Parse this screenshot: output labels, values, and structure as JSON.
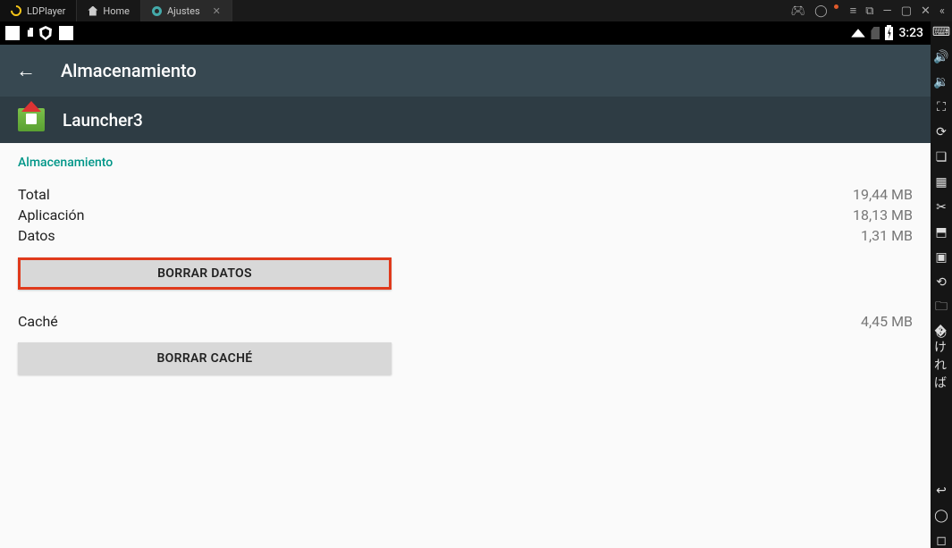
{
  "window": {
    "app_name": "LDPlayer",
    "tabs": [
      {
        "label": "Home"
      },
      {
        "label": "Ajustes"
      }
    ]
  },
  "status_bar": {
    "time": "3:23"
  },
  "appbar": {
    "title": "Almacenamiento"
  },
  "app_info": {
    "name": "Launcher3"
  },
  "storage": {
    "section_label": "Almacenamiento",
    "rows": {
      "total": {
        "label": "Total",
        "value": "19,44 MB"
      },
      "app": {
        "label": "Aplicación",
        "value": "18,13 MB"
      },
      "data": {
        "label": "Datos",
        "value": "1,31 MB"
      }
    },
    "clear_data_button": "BORRAR DATOS",
    "cache": {
      "label": "Caché",
      "value": "4,45 MB"
    },
    "clear_cache_button": "BORRAR CACHÉ"
  }
}
